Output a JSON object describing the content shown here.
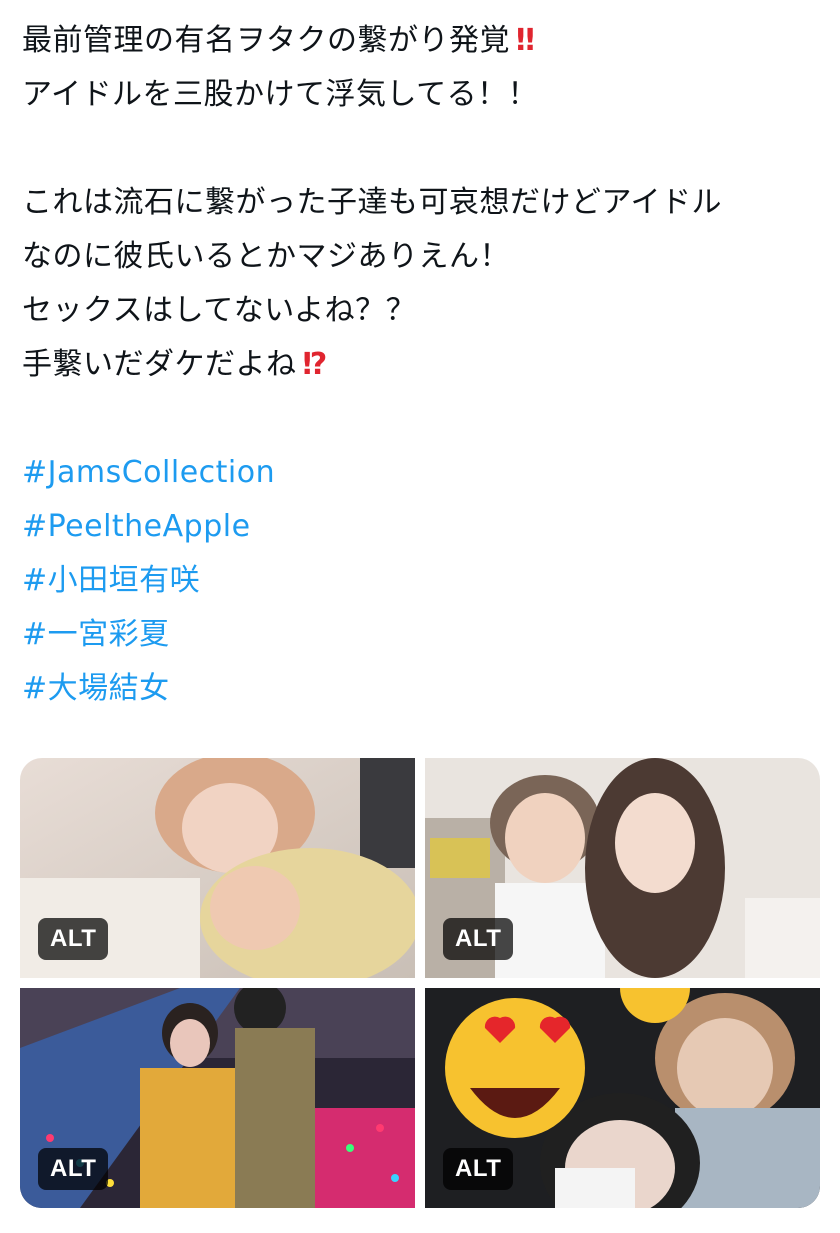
{
  "tweet": {
    "lines": [
      {
        "text": "最前管理の有名ヲタクの繋がり発覚",
        "emoji": "‼"
      },
      {
        "text": "アイドルを三股かけて浮気してる！！",
        "emoji": ""
      },
      {
        "text": "",
        "emoji": ""
      },
      {
        "text": "これは流石に繋がった子達も可哀想だけどアイドル",
        "emoji": ""
      },
      {
        "text": "なのに彼氏いるとかマジありえん！",
        "emoji": ""
      },
      {
        "text": "セックスはしてないよね？？",
        "emoji": ""
      },
      {
        "text": "手繋いだダケだよね",
        "emoji": "⁉"
      }
    ],
    "hashtags": [
      "#JamsCollection",
      "#PeeltheApple",
      "#小田垣有咲",
      "#一宮彩夏",
      "#大場結女"
    ]
  },
  "media": [
    {
      "alt_label": "ALT",
      "icon": "photo-couple-closeup"
    },
    {
      "alt_label": "ALT",
      "icon": "photo-couple-selfie-room"
    },
    {
      "alt_label": "ALT",
      "icon": "photo-couple-lights"
    },
    {
      "alt_label": "ALT",
      "icon": "photo-selfie-emoji-sticker"
    }
  ],
  "colors": {
    "hashtag": "#1d9bf0",
    "emoji_red": "#e0252f",
    "text": "#0f1419"
  }
}
